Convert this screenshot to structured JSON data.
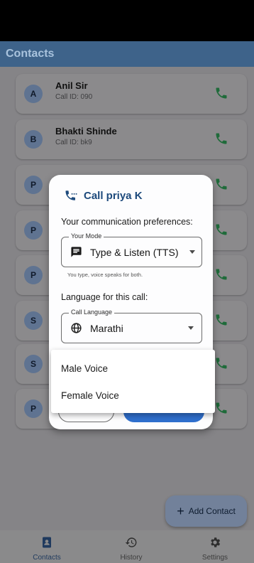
{
  "app": {
    "title": "Contacts"
  },
  "contacts": [
    {
      "initial": "A",
      "name": "Anil Sir",
      "sub": "Call ID: 090"
    },
    {
      "initial": "B",
      "name": "Bhakti Shinde",
      "sub": "Call ID: bk9"
    },
    {
      "initial": "P",
      "name": "",
      "sub": ""
    },
    {
      "initial": "P",
      "name": "",
      "sub": ""
    },
    {
      "initial": "P",
      "name": "",
      "sub": ""
    },
    {
      "initial": "S",
      "name": "",
      "sub": ""
    },
    {
      "initial": "S",
      "name": "",
      "sub": ""
    },
    {
      "initial": "P",
      "name": "",
      "sub": ""
    }
  ],
  "fab": {
    "label": "Add Contact"
  },
  "nav": [
    {
      "label": "Contacts",
      "icon": "contacts-icon",
      "active": true
    },
    {
      "label": "History",
      "icon": "history-icon",
      "active": false
    },
    {
      "label": "Settings",
      "icon": "gear-icon",
      "active": false
    }
  ],
  "dialog": {
    "title": "Call priya K",
    "prefs_label": "Your communication preferences:",
    "mode": {
      "label": "Your Mode",
      "value": "Type & Listen (TTS)",
      "helper": "You type, voice speaks for both."
    },
    "language_label": "Language for this call:",
    "language": {
      "label": "Call Language",
      "value": "Marathi"
    }
  },
  "voice_menu": {
    "options": [
      "Male Voice",
      "Female Voice"
    ]
  },
  "colors": {
    "accent": "#1d4a7c",
    "call_green": "#1f6b3a",
    "primary_button": "#2f6fcd"
  }
}
